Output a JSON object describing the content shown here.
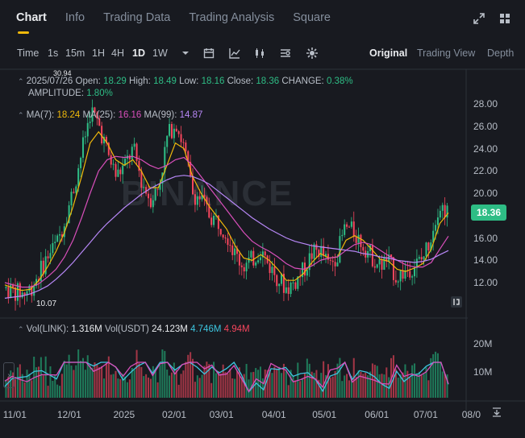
{
  "tabs": [
    {
      "label": "Chart",
      "active": true
    },
    {
      "label": "Info"
    },
    {
      "label": "Trading Data"
    },
    {
      "label": "Trading Analysis"
    },
    {
      "label": "Square"
    }
  ],
  "toolbar": {
    "time_label": "Time",
    "intervals": [
      "1s",
      "15m",
      "1H",
      "4H",
      "1D",
      "1W"
    ],
    "active_interval": "1D",
    "views": [
      "Original",
      "Trading View",
      "Depth"
    ],
    "active_view": "Original"
  },
  "ohlc": {
    "date": "2025/07/26",
    "open_label": "Open:",
    "open": "18.29",
    "high_label": "High:",
    "high": "18.49",
    "low_label": "Low:",
    "low": "18.16",
    "close_label": "Close:",
    "close": "18.36",
    "change_label": "CHANGE:",
    "change": "0.38%",
    "amplitude_label": "AMPLITUDE:",
    "amplitude": "1.80%"
  },
  "ma": {
    "ma7_label": "MA(7):",
    "ma7": "18.24",
    "ma25_label": "MA(25):",
    "ma25": "16.16",
    "ma99_label": "MA(99):",
    "ma99": "14.87"
  },
  "volume": {
    "vol_link_label": "Vol(LINK):",
    "vol_link": "1.316M",
    "vol_usdt_label": "Vol(USDT)",
    "vol_usdt": "24.123M",
    "v1": "4.746M",
    "v2": "4.94M",
    "axis": [
      "20M",
      "10M"
    ]
  },
  "watermark": "BINANCE",
  "price_badge": "18.36",
  "high_marker": "30.94",
  "low_marker": "10.07",
  "colors": {
    "up": "#2ebd85",
    "down": "#f6465d",
    "ma7": "#f0b90b",
    "ma25": "#d94fbb",
    "ma99": "#b888f8",
    "accent": "#f0b90b"
  },
  "chart_data": {
    "type": "candlestick",
    "y_ticks": [
      "28.00",
      "26.00",
      "24.00",
      "22.00",
      "20.00",
      "16.00",
      "14.00",
      "12.00"
    ],
    "x_ticks": [
      "11/01",
      "12/01",
      "2025",
      "02/01",
      "03/01",
      "04/01",
      "05/01",
      "06/01",
      "07/01",
      "08/0"
    ],
    "ylim": [
      10,
      30
    ],
    "close_path": [
      11.5,
      11.2,
      11.0,
      11.6,
      13.0,
      14.5,
      15.5,
      17.8,
      20.5,
      24.0,
      27.5,
      26.0,
      23.5,
      21.5,
      22.5,
      24.0,
      21.0,
      19.5,
      20.5,
      25.0,
      26.5,
      24.0,
      20.0,
      19.5,
      18.0,
      17.5,
      16.5,
      14.5,
      13.5,
      14.0,
      15.0,
      13.5,
      12.5,
      11.5,
      12.0,
      13.0,
      14.5,
      15.0,
      13.5,
      14.5,
      17.0,
      16.5,
      15.5,
      14.5,
      13.5,
      14.0,
      12.5,
      13.0,
      13.5,
      14.0,
      16.0,
      19.0,
      18.36
    ],
    "ma7_path": [
      11.8,
      11.5,
      11.3,
      11.4,
      12.2,
      13.4,
      14.8,
      16.5,
      18.8,
      21.5,
      24.5,
      25.5,
      24.5,
      23.0,
      22.5,
      23.0,
      22.0,
      20.5,
      20.5,
      22.5,
      24.5,
      24.0,
      21.5,
      20.0,
      18.8,
      17.8,
      16.8,
      15.3,
      14.2,
      14.0,
      14.5,
      14.0,
      13.2,
      12.2,
      12.2,
      12.8,
      13.8,
      14.6,
      14.2,
      14.3,
      15.8,
      16.2,
      15.8,
      15.0,
      14.1,
      13.9,
      13.2,
      13.0,
      13.3,
      13.7,
      15.0,
      17.3,
      18.24
    ],
    "ma25_path": [
      12.0,
      11.8,
      11.6,
      11.6,
      11.9,
      12.5,
      13.2,
      14.3,
      15.8,
      17.8,
      20.0,
      22.0,
      23.0,
      23.3,
      23.2,
      23.3,
      23.0,
      22.5,
      22.2,
      22.5,
      23.0,
      23.2,
      22.5,
      21.5,
      20.5,
      19.5,
      18.5,
      17.5,
      16.5,
      15.7,
      15.2,
      14.8,
      14.3,
      13.7,
      13.3,
      13.2,
      13.5,
      14.0,
      14.2,
      14.3,
      14.9,
      15.4,
      15.6,
      15.4,
      14.9,
      14.4,
      14.0,
      13.6,
      13.4,
      13.4,
      13.8,
      15.0,
      16.16
    ],
    "ma99_path": [
      10.6,
      10.7,
      10.8,
      11.0,
      11.3,
      11.7,
      12.3,
      13.0,
      13.8,
      14.7,
      15.6,
      16.5,
      17.3,
      18.0,
      18.7,
      19.3,
      19.9,
      20.4,
      20.8,
      21.2,
      21.5,
      21.6,
      21.5,
      21.2,
      20.8,
      20.2,
      19.6,
      19.0,
      18.4,
      17.8,
      17.3,
      16.8,
      16.4,
      16.0,
      15.7,
      15.5,
      15.3,
      15.2,
      15.1,
      15.0,
      14.9,
      14.8,
      14.6,
      14.5,
      14.3,
      14.2,
      14.0,
      13.9,
      13.8,
      13.9,
      14.1,
      14.5,
      14.87
    ]
  }
}
